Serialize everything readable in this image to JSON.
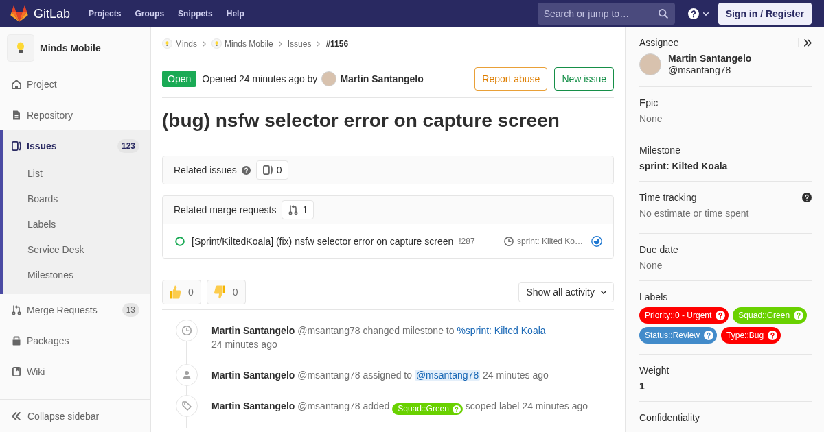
{
  "navbar": {
    "brand": "GitLab",
    "links": [
      "Projects",
      "Groups",
      "Snippets",
      "Help"
    ],
    "search": {
      "placeholder": "Search or jump to…"
    },
    "sign_in": "Sign in / Register"
  },
  "sidebar": {
    "project": "Minds Mobile",
    "items": [
      {
        "kind": "project",
        "label": "Project",
        "selected": false
      },
      {
        "kind": "repository",
        "label": "Repository",
        "selected": false
      },
      {
        "kind": "issues",
        "label": "Issues",
        "count": "123",
        "selected": true,
        "children": [
          {
            "label": "List",
            "selected": false
          },
          {
            "label": "Boards",
            "selected": false
          },
          {
            "label": "Labels",
            "selected": false
          },
          {
            "label": "Service Desk",
            "selected": false
          },
          {
            "label": "Milestones",
            "selected": false
          }
        ]
      },
      {
        "kind": "merge-requests",
        "label": "Merge Requests",
        "count": "13",
        "selected": false
      },
      {
        "kind": "packages",
        "label": "Packages",
        "selected": false
      },
      {
        "kind": "wiki",
        "label": "Wiki",
        "selected": false
      }
    ],
    "collapse": "Collapse sidebar"
  },
  "breadcrumbs": [
    {
      "kind": "group",
      "label": "Minds"
    },
    {
      "kind": "project",
      "label": "Minds Mobile"
    },
    {
      "kind": "page",
      "label": "Issues"
    },
    {
      "kind": "current",
      "label": "#1156"
    }
  ],
  "issue": {
    "status": {
      "kind": "open",
      "label": "Open"
    },
    "opened": "Opened 24 minutes ago by",
    "author": "Martin Santangelo",
    "actions": [
      {
        "kind": "warning",
        "label": "Report abuse"
      },
      {
        "kind": "success",
        "label": "New issue"
      }
    ],
    "title": "(bug) nsfw selector error on capture screen"
  },
  "related_issues": {
    "title": "Related issues",
    "count": "0"
  },
  "related_merge_requests": {
    "title": "Related merge requests",
    "count": "1",
    "items": [
      {
        "kind": "open",
        "title": "[Sprint/KiltedKoala] (fix) nsfw selector error on capture screen",
        "ref": "!287",
        "milestone": "sprint: Kilted Ko…",
        "pipeline": {
          "kind": "running"
        }
      }
    ]
  },
  "awards": [
    {
      "kind": "thumbsup",
      "count": "0"
    },
    {
      "kind": "thumbsdown",
      "count": "0"
    }
  ],
  "activity_filter": "Show all activity",
  "notes": [
    {
      "kind": "milestone",
      "text": "**Martin Santangelo** @msantang78 changed milestone to",
      "link": "%sprint: Kilted Koala",
      "time": "24 minutes ago"
    },
    {
      "kind": "assignee",
      "text": "**Martin Santangelo** @msantang78 assigned to",
      "mention": "@msantang78",
      "time": "24 minutes ago"
    },
    {
      "kind": "label",
      "text": "**Martin Santangelo** @msantang78 added",
      "label": {
        "name": "Squad::Green",
        "color": "#69d100"
      },
      "after": "scoped label",
      "time": "24 minutes ago"
    }
  ],
  "details": {
    "sections": [
      {
        "kind": "assignee",
        "heading": "Assignee",
        "help": false,
        "name": "Martin Santangelo",
        "username": "@msantang78"
      },
      {
        "kind": "text",
        "heading": "Epic",
        "help": false,
        "value": "None",
        "muted": true
      },
      {
        "kind": "text",
        "heading": "Milestone",
        "help": false,
        "value": "sprint: Kilted Koala",
        "muted": false
      },
      {
        "kind": "time-tracking",
        "heading": "Time tracking",
        "help": true,
        "value": "No estimate or time spent",
        "muted": true
      },
      {
        "kind": "text",
        "heading": "Due date",
        "help": false,
        "value": "None",
        "muted": true
      },
      {
        "kind": "labels",
        "heading": "Labels",
        "help": false,
        "labels": [
          {
            "name": "Priority::0 - Urgent",
            "color": "#ff0000"
          },
          {
            "name": "Squad::Green",
            "color": "#69d100"
          },
          {
            "name": "Status::Review",
            "color": "#428bca"
          },
          {
            "name": "Type::Bug",
            "color": "#ff0000"
          }
        ]
      },
      {
        "kind": "text",
        "heading": "Weight",
        "help": false,
        "value": "1",
        "muted": false
      },
      {
        "kind": "text",
        "heading": "Confidentiality",
        "help": false
      }
    ]
  }
}
